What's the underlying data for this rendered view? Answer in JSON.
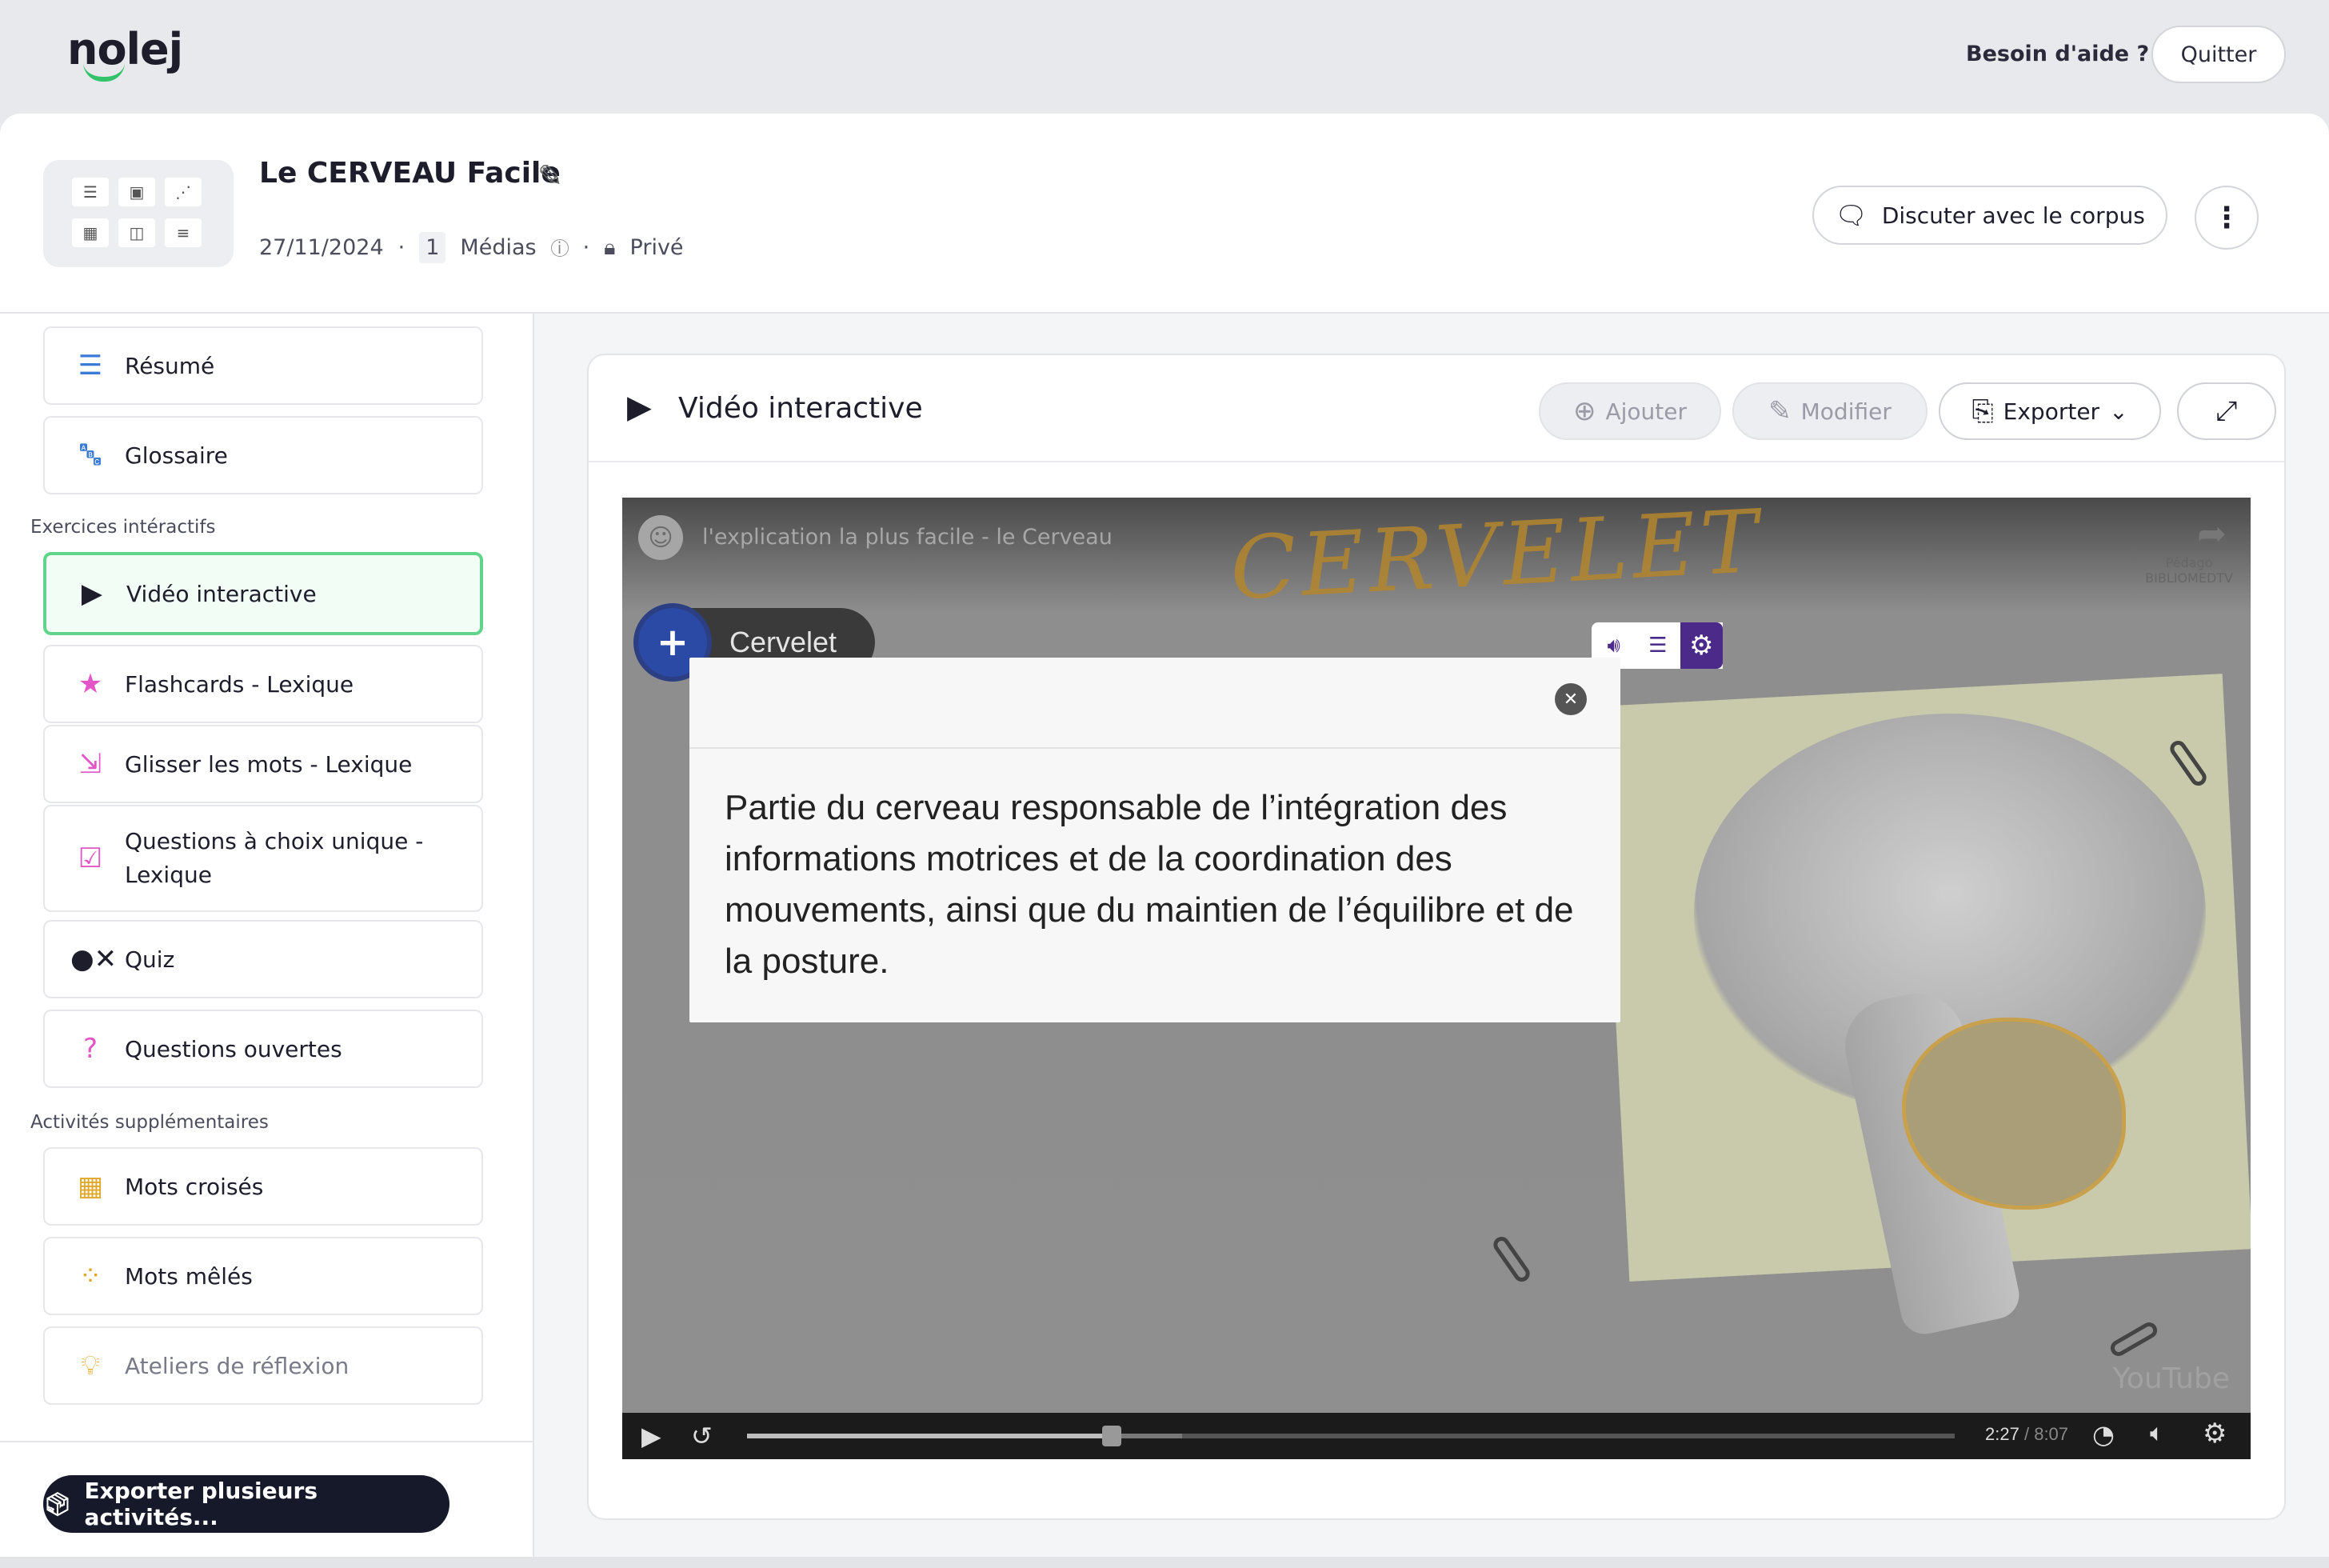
{
  "topbar": {
    "logo": "nolej",
    "help_label": "Besoin d'aide ?",
    "quit_label": "Quitter"
  },
  "project": {
    "title": "Le CERVEAU Facile",
    "date": "27/11/2024",
    "media_count": "1",
    "media_label": "Médias",
    "visibility": "Privé",
    "discuss_label": "Discuter avec le corpus"
  },
  "sidebar": {
    "top_items": [
      {
        "label": "Résumé",
        "icon": "list-icon"
      },
      {
        "label": "Glossaire",
        "icon": "glossary-icon"
      }
    ],
    "section_interactive": "Exercices intéractifs",
    "interactive_items": [
      {
        "label": "Vidéo interactive",
        "icon": "interactive-video-icon",
        "active": true
      },
      {
        "label": "Flashcards - Lexique",
        "icon": "flashcards-icon"
      },
      {
        "label": "Glisser les mots - Lexique",
        "icon": "drag-words-icon"
      },
      {
        "label_line1": "Questions à choix unique -",
        "label_line2": "Lexique",
        "icon": "single-choice-icon"
      },
      {
        "label": "Quiz",
        "icon": "quiz-icon"
      },
      {
        "label": "Questions ouvertes",
        "icon": "open-questions-icon"
      }
    ],
    "section_extra": "Activités supplémentaires",
    "extra_items": [
      {
        "label": "Mots croisés",
        "icon": "crossword-icon"
      },
      {
        "label": "Mots mêlés",
        "icon": "word-search-icon"
      },
      {
        "label": "Ateliers de réflexion",
        "icon": "lightbulb-icon",
        "muted": true
      }
    ],
    "export_multi_label": "Exporter plusieurs activités..."
  },
  "panel": {
    "title": "Vidéo interactive",
    "add_label": "Ajouter",
    "edit_label": "Modifier",
    "export_label": "Exporter"
  },
  "video": {
    "title": "l'explication la plus facile - le Cerveau",
    "overlay_word": "CERVELET",
    "channel_line1": "Pédago",
    "channel_line2": "BIBLIOMEDTV",
    "watermark": "YouTube",
    "hotspot_label": "Cervelet",
    "popup_text": "Partie du cerveau responsable de l’intégration des informations motrices et de la coordination des mouvements, ainsi que du maintien de l’équilibre et de la posture.",
    "current_time": "2:27",
    "separator": "/",
    "duration": "8:07",
    "progress": 0.302,
    "buffered": 0.36
  },
  "colors": {
    "accent_green": "#5fd48a",
    "dark_button": "#151929",
    "hotspot_blue": "#2a4aa5",
    "toolbar_purple": "#4b2a8a"
  }
}
